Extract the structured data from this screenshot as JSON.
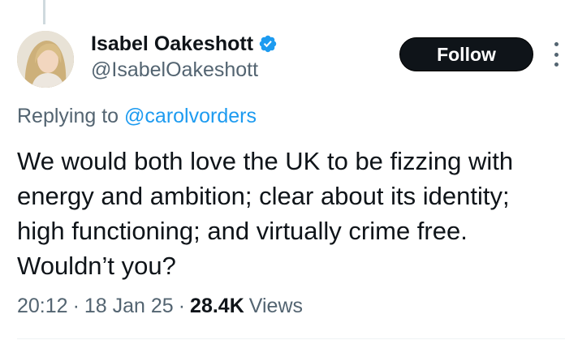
{
  "colors": {
    "accent": "#1d9bf0",
    "text_primary": "#0f1419",
    "text_secondary": "#536471",
    "follow_bg": "#0f1419"
  },
  "author": {
    "display_name": "Isabel Oakeshott",
    "handle": "@IsabelOakeshott",
    "verified_icon": "verified-badge-icon",
    "avatar_icon": "profile-photo"
  },
  "actions": {
    "follow_label": "Follow",
    "more_icon": "more-options-icon"
  },
  "reply": {
    "prefix": "Replying to ",
    "to_handle": "@carolvorders"
  },
  "tweet": {
    "text": "We would both love the UK to be fizzing with\nenergy and ambition; clear about its identity;\nhigh functioning; and virtually crime free.\nWouldn’t you?"
  },
  "meta": {
    "time": "20:12",
    "separator": "·",
    "date": "18 Jan 25",
    "views_count": "28.4K",
    "views_label": "Views"
  }
}
